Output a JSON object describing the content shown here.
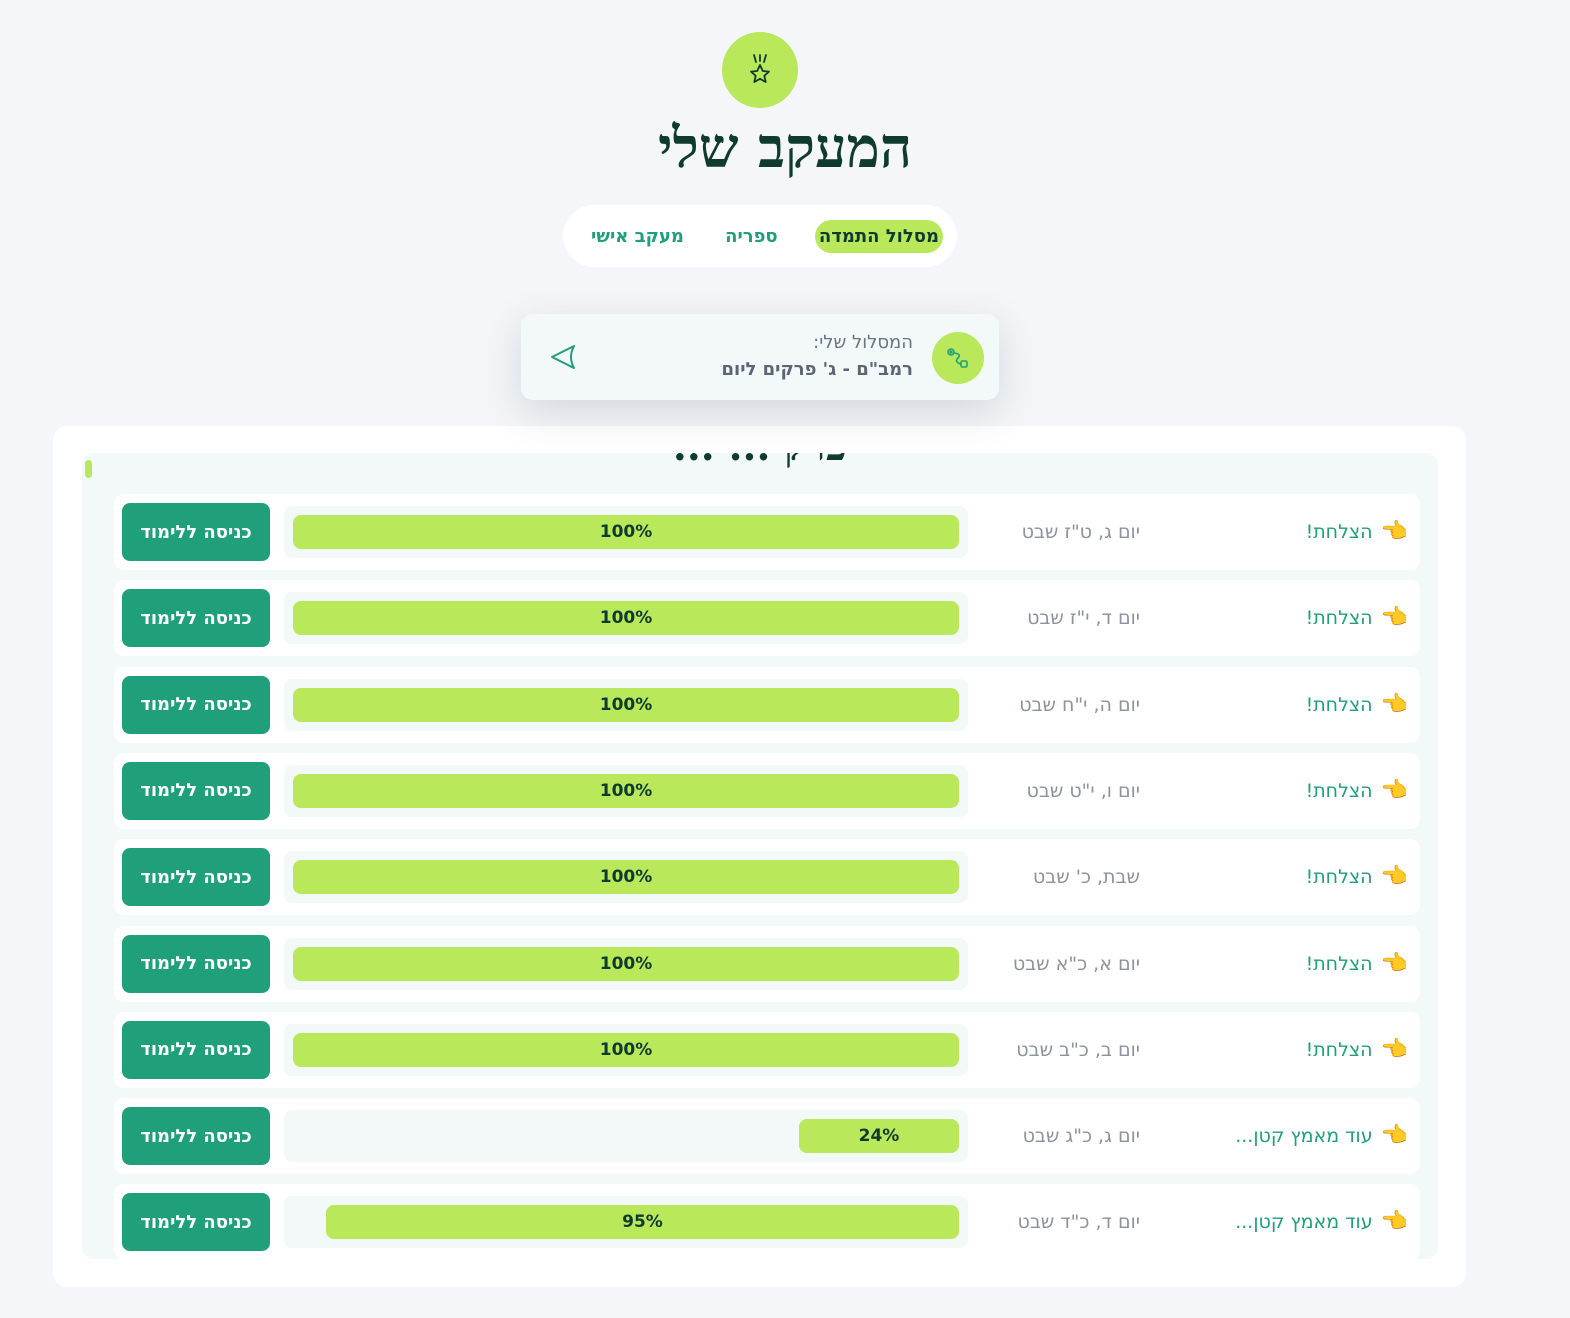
{
  "header": {
    "icon": "medal-icon",
    "title": "המעקב שלי"
  },
  "tabs": [
    {
      "label": "מסלול התמדה",
      "active": true
    },
    {
      "label": "ספריה",
      "active": false
    },
    {
      "label": "מעקב אישי",
      "active": false
    }
  ],
  "route": {
    "label": "המסלול שלי:",
    "value": "רמב\"ם - ג' פרקים ליום",
    "icon": "route-icon",
    "nav_icon": "chevron-left-icon"
  },
  "section": {
    "title": "פרק ... ..."
  },
  "button_label": "כניסה ללימוד",
  "rows": [
    {
      "status": "הצלחת!",
      "date": "יום ג, ט\"ז שבט",
      "progress": 100,
      "progress_label": "100%"
    },
    {
      "status": "הצלחת!",
      "date": "יום ד, י\"ז שבט",
      "progress": 100,
      "progress_label": "100%"
    },
    {
      "status": "הצלחת!",
      "date": "יום ה, י\"ח שבט",
      "progress": 100,
      "progress_label": "100%"
    },
    {
      "status": "הצלחת!",
      "date": "יום ו, י\"ט שבט",
      "progress": 100,
      "progress_label": "100%"
    },
    {
      "status": "הצלחת!",
      "date": "שבת, כ' שבט",
      "progress": 100,
      "progress_label": "100%"
    },
    {
      "status": "הצלחת!",
      "date": "יום א, כ\"א שבט",
      "progress": 100,
      "progress_label": "100%"
    },
    {
      "status": "הצלחת!",
      "date": "יום ב, כ\"ב שבט",
      "progress": 100,
      "progress_label": "100%"
    },
    {
      "status": "עוד מאמץ קטן...",
      "date": "יום ג, כ\"ג שבט",
      "progress": 24,
      "progress_label": "24%"
    },
    {
      "status": "עוד מאמץ קטן...",
      "date": "יום ד, כ\"ד שבט",
      "progress": 95,
      "progress_label": "95%"
    }
  ],
  "status_icon": "pointing-hand-icon",
  "colors": {
    "accent_lime": "#b9e85a",
    "primary_green": "#1fa07a",
    "dark_green": "#0f3b2f",
    "background": "#f4f6f9"
  }
}
